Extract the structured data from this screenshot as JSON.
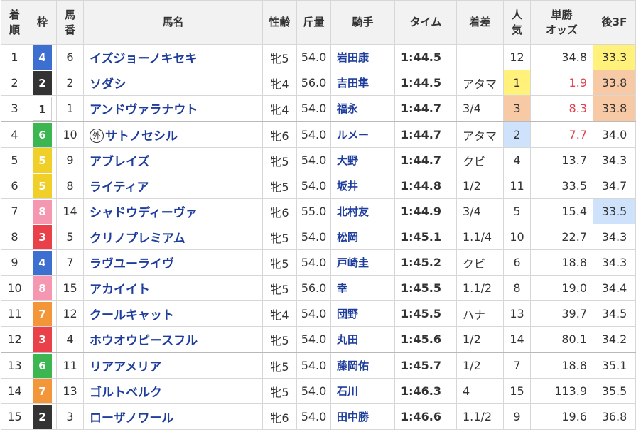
{
  "headers": {
    "rank": [
      "着",
      "順"
    ],
    "waku": "枠",
    "umaban": [
      "馬",
      "番"
    ],
    "horse": "馬名",
    "sexage": "性齢",
    "weight": "斤量",
    "jockey": "騎手",
    "time": "タイム",
    "margin": "着差",
    "popularity": [
      "人",
      "気"
    ],
    "odds": [
      "単勝",
      "オッズ"
    ],
    "last3f": "後3F"
  },
  "foreign_mark": "外",
  "colors": {
    "waku_1": "#ffffff",
    "waku_2": "#333333",
    "waku_3": "#e9404a",
    "waku_4": "#3c6fd0",
    "waku_5": "#f0cf29",
    "waku_6": "#3cb650",
    "waku_7": "#f3963a",
    "waku_8": "#f597b0",
    "highlight_1st": "#fff17a",
    "highlight_2nd": "#cfe2fb",
    "highlight_3rd": "#f7c9a4",
    "odds_top3": "#e0434e",
    "link_blue": "#1e3d9c"
  },
  "rows": [
    {
      "rank": "1",
      "waku": "4",
      "umaban": "6",
      "name": "イズジョーノキセキ",
      "foreign": false,
      "sexage": "牝5",
      "weight": "54.0",
      "jockey": "岩田康",
      "time": "1:44.5",
      "margin": "",
      "pop": "12",
      "odds": "34.8",
      "last3f": "33.3"
    },
    {
      "rank": "2",
      "waku": "2",
      "umaban": "2",
      "name": "ソダシ",
      "foreign": false,
      "sexage": "牝4",
      "weight": "56.0",
      "jockey": "吉田隼",
      "time": "1:44.5",
      "margin": "アタマ",
      "pop": "1",
      "odds": "1.9",
      "last3f": "33.8"
    },
    {
      "rank": "3",
      "waku": "1",
      "umaban": "1",
      "name": "アンドヴァラナウト",
      "foreign": false,
      "sexage": "牝4",
      "weight": "54.0",
      "jockey": "福永",
      "time": "1:44.7",
      "margin": "3/4",
      "pop": "3",
      "odds": "8.3",
      "last3f": "33.8"
    },
    {
      "rank": "4",
      "waku": "6",
      "umaban": "10",
      "name": "サトノセシル",
      "foreign": true,
      "sexage": "牝6",
      "weight": "54.0",
      "jockey": "ルメー",
      "time": "1:44.7",
      "margin": "アタマ",
      "pop": "2",
      "odds": "7.7",
      "last3f": "34.0"
    },
    {
      "rank": "5",
      "waku": "5",
      "umaban": "9",
      "name": "アブレイズ",
      "foreign": false,
      "sexage": "牝5",
      "weight": "54.0",
      "jockey": "大野",
      "time": "1:44.7",
      "margin": "クビ",
      "pop": "4",
      "odds": "13.7",
      "last3f": "34.3"
    },
    {
      "rank": "6",
      "waku": "5",
      "umaban": "8",
      "name": "ライティア",
      "foreign": false,
      "sexage": "牝5",
      "weight": "54.0",
      "jockey": "坂井",
      "time": "1:44.8",
      "margin": "1/2",
      "pop": "11",
      "odds": "33.5",
      "last3f": "34.7"
    },
    {
      "rank": "7",
      "waku": "8",
      "umaban": "14",
      "name": "シャドウディーヴァ",
      "foreign": false,
      "sexage": "牝6",
      "weight": "55.0",
      "jockey": "北村友",
      "time": "1:44.9",
      "margin": "3/4",
      "pop": "5",
      "odds": "15.4",
      "last3f": "33.5"
    },
    {
      "rank": "8",
      "waku": "3",
      "umaban": "5",
      "name": "クリノプレミアム",
      "foreign": false,
      "sexage": "牝5",
      "weight": "54.0",
      "jockey": "松岡",
      "time": "1:45.1",
      "margin": "1.1/4",
      "pop": "10",
      "odds": "22.7",
      "last3f": "34.3"
    },
    {
      "rank": "9",
      "waku": "4",
      "umaban": "7",
      "name": "ラヴユーライヴ",
      "foreign": false,
      "sexage": "牝5",
      "weight": "54.0",
      "jockey": "戸崎圭",
      "time": "1:45.2",
      "margin": "クビ",
      "pop": "6",
      "odds": "18.8",
      "last3f": "34.3"
    },
    {
      "rank": "10",
      "waku": "8",
      "umaban": "15",
      "name": "アカイイト",
      "foreign": false,
      "sexage": "牝5",
      "weight": "56.0",
      "jockey": "幸",
      "time": "1:45.5",
      "margin": "1.1/2",
      "pop": "8",
      "odds": "19.0",
      "last3f": "34.4"
    },
    {
      "rank": "11",
      "waku": "7",
      "umaban": "12",
      "name": "クールキャット",
      "foreign": false,
      "sexage": "牝4",
      "weight": "54.0",
      "jockey": "団野",
      "time": "1:45.5",
      "margin": "ハナ",
      "pop": "13",
      "odds": "39.7",
      "last3f": "34.5"
    },
    {
      "rank": "12",
      "waku": "3",
      "umaban": "4",
      "name": "ホウオウピースフル",
      "foreign": false,
      "sexage": "牝5",
      "weight": "54.0",
      "jockey": "丸田",
      "time": "1:45.6",
      "margin": "1/2",
      "pop": "14",
      "odds": "80.1",
      "last3f": "34.2"
    },
    {
      "rank": "13",
      "waku": "6",
      "umaban": "11",
      "name": "リアアメリア",
      "foreign": false,
      "sexage": "牝5",
      "weight": "54.0",
      "jockey": "藤岡佑",
      "time": "1:45.7",
      "margin": "1/2",
      "pop": "7",
      "odds": "18.8",
      "last3f": "35.1"
    },
    {
      "rank": "14",
      "waku": "7",
      "umaban": "13",
      "name": "ゴルトベルク",
      "foreign": false,
      "sexage": "牝5",
      "weight": "54.0",
      "jockey": "石川",
      "time": "1:46.3",
      "margin": "4",
      "pop": "15",
      "odds": "113.9",
      "last3f": "35.5"
    },
    {
      "rank": "15",
      "waku": "2",
      "umaban": "3",
      "name": "ローザノワール",
      "foreign": false,
      "sexage": "牝6",
      "weight": "54.0",
      "jockey": "田中勝",
      "time": "1:46.6",
      "margin": "1.1/2",
      "pop": "9",
      "odds": "19.6",
      "last3f": "36.8"
    }
  ]
}
